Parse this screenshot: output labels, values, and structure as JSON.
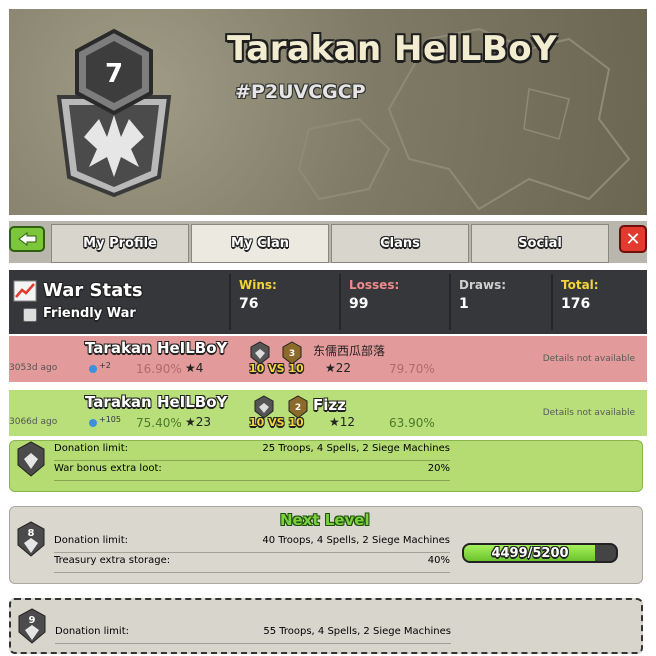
{
  "clan": {
    "level": "7",
    "name": "Tarakan HeILBoY",
    "tag": "#P2UVCGCP"
  },
  "tabs": [
    {
      "label": "My Profile"
    },
    {
      "label": "My Clan"
    },
    {
      "label": "Clans"
    },
    {
      "label": "Social"
    }
  ],
  "war_stats": {
    "title": "War Stats",
    "friendly_label": "Friendly War",
    "wins_label": "Wins:",
    "wins": "76",
    "losses_label": "Losses:",
    "losses": "99",
    "draws_label": "Draws:",
    "draws": "1",
    "total_label": "Total:",
    "total": "176"
  },
  "war_log": [
    {
      "result": "loss",
      "age": "3053d ago",
      "clan_name": "Tarakan HeILBoY",
      "xp": "+2",
      "clan_pct": "16.90%",
      "clan_stars": "4",
      "clan_level": "3",
      "size": "10 VS 10",
      "opponent_name": "东儒西瓜部落",
      "opp_stars": "22",
      "opp_pct": "79.70%",
      "details": "Details not available"
    },
    {
      "result": "win",
      "age": "3066d ago",
      "clan_name": "Tarakan HeILBoY",
      "xp": "+105",
      "clan_pct": "75.40%",
      "clan_stars": "23",
      "clan_level": "2",
      "size": "10 VS 10",
      "opponent_name": "Fizz",
      "opp_stars": "12",
      "opp_pct": "63.90%",
      "details": "Details not available"
    }
  ],
  "levels": {
    "current": {
      "donation_label": "Donation limit:",
      "donation_value": "25 Troops, 4 Spells, 2 Siege Machines",
      "bonus_label": "War bonus extra loot:",
      "bonus_value": "20%"
    },
    "next": {
      "heading": "Next Level",
      "level": "8",
      "donation_label": "Donation limit:",
      "donation_value": "40 Troops, 4 Spells, 2 Siege Machines",
      "treasury_label": "Treasury extra storage:",
      "treasury_value": "40%",
      "progress_text": "4499/5200",
      "progress_fraction": 0.865
    },
    "future": {
      "level": "9",
      "donation_label": "Donation limit:",
      "donation_value": "55 Troops, 4 Spells, 2 Siege Machines"
    }
  },
  "colors": {
    "loss_row": "#e59a9a",
    "win_row": "#b9e07c",
    "accent_green": "#7ad13a"
  }
}
